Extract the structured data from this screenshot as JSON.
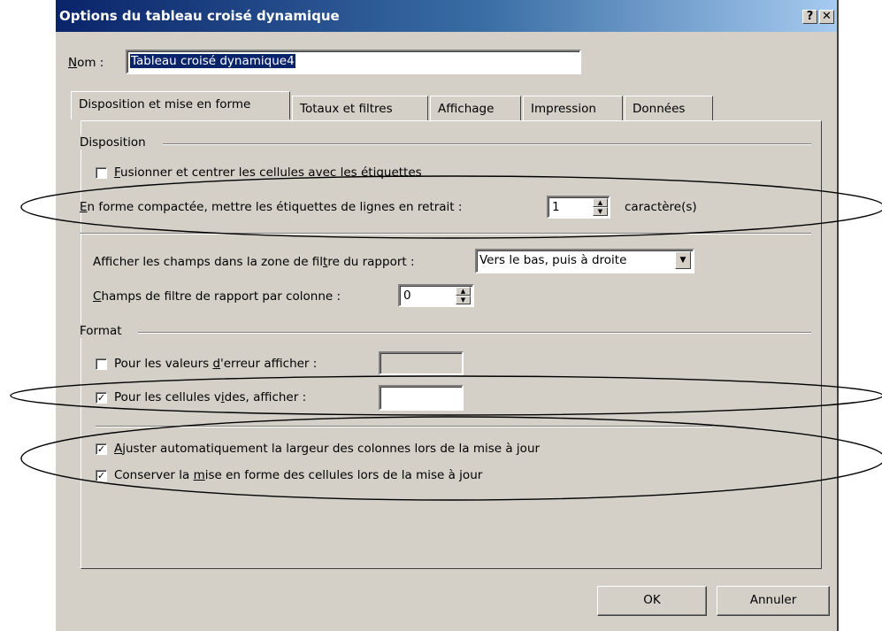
{
  "dialog": {
    "title": "Options du tableau croisé dynamique",
    "help_label": "?",
    "close_label": "✕",
    "name_label": "Nom :",
    "name_value": "Tableau croisé dynamique4",
    "tabs": [
      {
        "label": "Disposition et mise en forme",
        "active": true
      },
      {
        "label": "Totaux et filtres"
      },
      {
        "label": "Affichage"
      },
      {
        "label": "Impression"
      },
      {
        "label": "Données"
      }
    ],
    "disposition": {
      "heading": "Disposition",
      "merge_center_label": "Fusionner et centrer les cellules avec les étiquettes",
      "merge_center_checked": false,
      "compact_indent_label": "En forme compactée, mettre les étiquettes de lignes en retrait :",
      "compact_indent_value": "1",
      "compact_indent_unit": "caractère(s)",
      "filter_area_label": "Afficher les champs dans la zone de filtre du rapport :",
      "filter_area_value": "Vers le bas, puis à droite",
      "filter_per_column_label": "Champs de filtre de rapport par colonne :",
      "filter_per_column_value": "0"
    },
    "format": {
      "heading": "Format",
      "error_values_label": "Pour les valeurs d'erreur afficher :",
      "error_values_checked": false,
      "error_values_value": "",
      "empty_cells_label": "Pour les cellules vides, afficher :",
      "empty_cells_checked": true,
      "empty_cells_value": "",
      "autofit_label": "Ajuster automatiquement la largeur des colonnes lors de la mise à jour",
      "autofit_checked": true,
      "preserve_format_label": "Conserver la mise en forme des cellules lors de la mise à jour",
      "preserve_format_checked": true
    },
    "ok_label": "OK",
    "cancel_label": "Annuler"
  }
}
